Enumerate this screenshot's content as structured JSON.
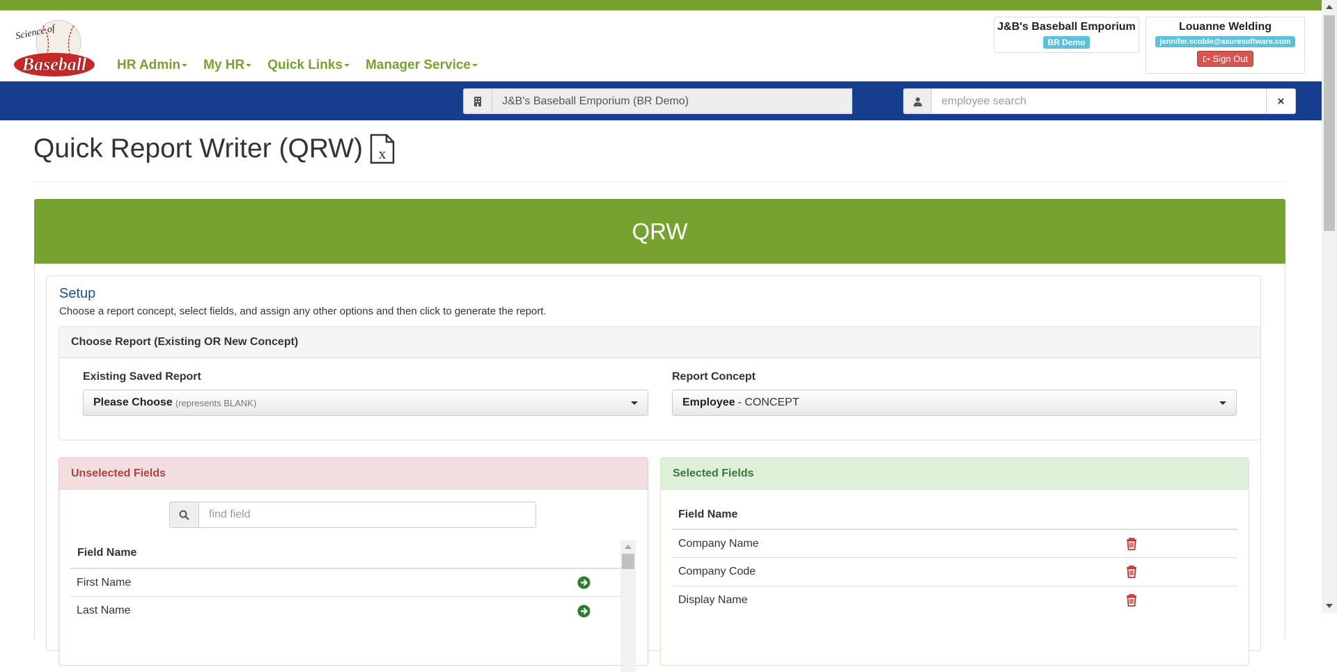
{
  "header": {
    "logo": {
      "line1": "Science of",
      "line2": "Baseball"
    },
    "nav": [
      {
        "label": "HR Admin"
      },
      {
        "label": "My HR"
      },
      {
        "label": "Quick Links"
      },
      {
        "label": "Manager Service"
      }
    ],
    "company_box": {
      "name": "J&B's Baseball Emporium",
      "badge": "BR Demo"
    },
    "user_box": {
      "name": "Louanne Welding",
      "email": "jennifer.scoble@asuresoftware.com",
      "signout": "Sign Out"
    }
  },
  "bluebar": {
    "company_value": "J&B's Baseball Emporium (BR Demo)",
    "employee_search_placeholder": "employee search",
    "clear_label": "×"
  },
  "page": {
    "title": "Quick Report Writer (QRW)"
  },
  "banner": {
    "title": "QRW"
  },
  "setup": {
    "title": "Setup",
    "description": "Choose a report concept, select fields, and assign any other options and then click to generate the report.",
    "choose_heading": "Choose Report (Existing OR New Concept)",
    "existing": {
      "label": "Existing Saved Report",
      "value_main": "Please Choose",
      "value_sub": "(represents BLANK)"
    },
    "concept": {
      "label": "Report Concept",
      "value_main": "Employee",
      "value_sub": "- CONCEPT"
    }
  },
  "unselected": {
    "heading": "Unselected Fields",
    "find_placeholder": "find field",
    "column": "Field Name",
    "rows": [
      "First Name",
      "Last Name"
    ]
  },
  "selected": {
    "heading": "Selected Fields",
    "column": "Field Name",
    "rows": [
      "Company Name",
      "Company Code",
      "Display Name"
    ]
  },
  "colors": {
    "brand_green": "#77a22f",
    "nav_blue": "#173e8e",
    "danger": "#d9534f",
    "info": "#5bc0de"
  }
}
